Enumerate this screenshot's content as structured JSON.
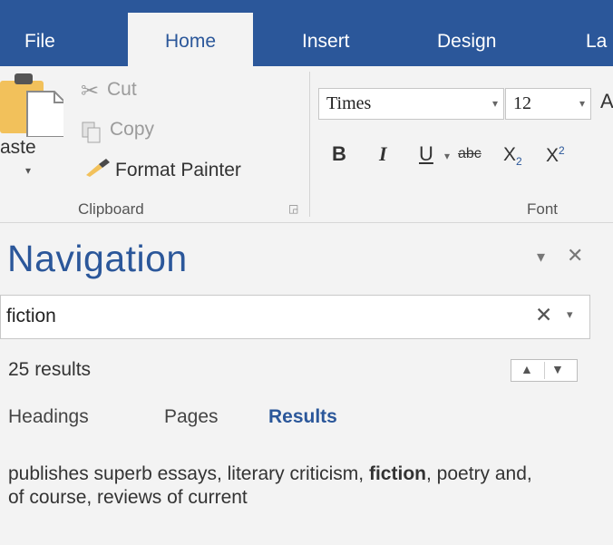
{
  "tabs": [
    {
      "label": "File"
    },
    {
      "label": "Home"
    },
    {
      "label": "Insert"
    },
    {
      "label": "Design"
    },
    {
      "label": "La"
    }
  ],
  "clipboard": {
    "paste_label": "aste",
    "cut_label": "Cut",
    "copy_label": "Copy",
    "format_painter_label": "Format Painter",
    "group_label": "Clipboard"
  },
  "font": {
    "font_name": "Times",
    "font_size": "12",
    "bold": "B",
    "italic": "I",
    "underline": "U",
    "strikethrough": "abc",
    "subscript": "X",
    "subscript_mark": "2",
    "superscript": "X",
    "superscript_mark": "2",
    "grow_font_partial": "A",
    "group_label": "Font"
  },
  "navigation": {
    "title": "Navigation",
    "search_value": "fiction",
    "results_count": "25 results",
    "tabs": [
      {
        "label": "Headings"
      },
      {
        "label": "Pages"
      },
      {
        "label": "Results"
      }
    ],
    "result_snippet": {
      "before": "publishes superb essays, literary criticism,",
      "match": "fiction",
      "after": ", poetry and, of course, reviews of current"
    }
  },
  "colors": {
    "accent": "#2b579a",
    "ribbon_bg": "#f3f3f3",
    "clipboard_icon": "#f2c15b"
  },
  "icons": [
    "paste-icon",
    "cut-icon",
    "copy-icon",
    "format-painter-icon",
    "dialog-launcher-icon",
    "dropdown-arrow-icon",
    "close-icon",
    "clear-search-icon",
    "up-arrow-icon",
    "down-arrow-icon"
  ]
}
